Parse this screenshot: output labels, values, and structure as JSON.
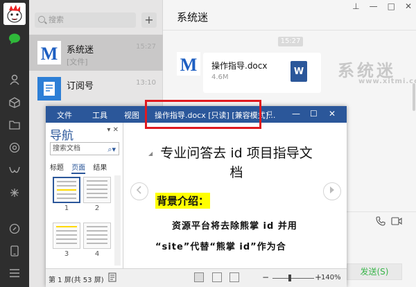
{
  "chat_list": {
    "search_placeholder": "搜索",
    "add_label": "+",
    "conversations": [
      {
        "name": "系统迷",
        "preview": "[文件]",
        "time": "15:27",
        "avatar_text": "M"
      },
      {
        "name": "订阅号",
        "preview": "",
        "time": "13:10"
      }
    ]
  },
  "chat": {
    "title": "系统迷",
    "window_buttons": [
      "⊥",
      "—",
      "□",
      "✕"
    ],
    "timestamp": "15:27",
    "avatar_text": "M",
    "file": {
      "name": "操作指导.docx",
      "size": "4.6M",
      "icon_text": "W"
    },
    "watermark": "系统迷",
    "watermark_sub": "www.xitmi.com",
    "send_label": "发送(S)"
  },
  "word": {
    "menus": [
      "文件",
      "工具",
      "视图"
    ],
    "doc_title": "操作指导.docx [只读] [兼容模式]...",
    "controls": [
      "⌑",
      "—",
      "☐",
      "✕"
    ],
    "nav": {
      "heading": "导航",
      "heading_controls": "▾ ✕",
      "search_placeholder": "搜索文档",
      "search_icon": "⌕▾",
      "tabs": [
        "标题",
        "页面",
        "结果"
      ],
      "pages": [
        "1",
        "2",
        "3",
        "4"
      ]
    },
    "document": {
      "heading": "专业问答去 id 项目指导文档",
      "highlight": "背景介绍：",
      "para1": "资源平台将去除熊掌 id 并用",
      "para2": "“site”代替“熊掌 id”作为合"
    },
    "status": {
      "page_info": "第 1 屏(共 53 屏)",
      "zoom_minus": "−",
      "zoom_plus": "+",
      "zoom": "140%"
    }
  },
  "colors": {
    "word_blue": "#2b579a",
    "wechat_green": "#39b54a",
    "rail_bg": "#2e2e2e",
    "highlight": "#ffff00",
    "red_box": "#e0191f"
  }
}
